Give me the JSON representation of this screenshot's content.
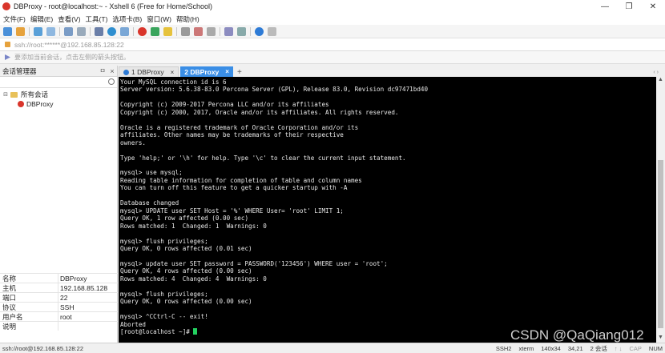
{
  "window": {
    "title": "DBProxy - root@localhost:~ - Xshell 6 (Free for Home/School)",
    "controls": [
      "—",
      "❐",
      "✕"
    ]
  },
  "menu": [
    "文件(F)",
    "编辑(E)",
    "查看(V)",
    "工具(T)",
    "选项卡(B)",
    "窗口(W)",
    "帮助(H)"
  ],
  "address": {
    "text": "ssh://root:******@192.168.85.128:22"
  },
  "hint": {
    "text": "要添加当前会话，点击左侧的箭头按钮。"
  },
  "sidebar": {
    "title": "会话管理器",
    "pin": "ㅁ",
    "close": "×",
    "tree": {
      "root_label": "所有会话",
      "session_label": "DBProxy"
    },
    "properties": [
      {
        "key": "名称",
        "value": "DBProxy"
      },
      {
        "key": "主机",
        "value": "192.168.85.128"
      },
      {
        "key": "端口",
        "value": "22"
      },
      {
        "key": "协议",
        "value": "SSH"
      },
      {
        "key": "用户名",
        "value": "root"
      },
      {
        "key": "说明",
        "value": ""
      }
    ]
  },
  "tabs": {
    "tab1": "1 DBProxy",
    "tab2": "2 DBProxy",
    "add": "+",
    "arrows": "‹ ›"
  },
  "terminal": {
    "text": "Your MySQL connection id is 6\nServer version: 5.6.38-83.0 Percona Server (GPL), Release 83.0, Revision dc97471bd40\n\nCopyright (c) 2009-2017 Percona LLC and/or its affiliates\nCopyright (c) 2000, 2017, Oracle and/or its affiliates. All rights reserved.\n\nOracle is a registered trademark of Oracle Corporation and/or its\naffiliates. Other names may be trademarks of their respective\nowners.\n\nType 'help;' or '\\h' for help. Type '\\c' to clear the current input statement.\n\nmysql> use mysql;\nReading table information for completion of table and column names\nYou can turn off this feature to get a quicker startup with -A\n\nDatabase changed\nmysql> UPDATE user SET Host = '%' WHERE User= 'root' LIMIT 1;\nQuery OK, 1 row affected (0.00 sec)\nRows matched: 1  Changed: 1  Warnings: 0\n\nmysql> flush privileges;\nQuery OK, 0 rows affected (0.01 sec)\n\nmysql> update user SET password = PASSWORD('123456') WHERE user = 'root';\nQuery OK, 4 rows affected (0.00 sec)\nRows matched: 4  Changed: 4  Warnings: 0\n\nmysql> flush privileges;\nQuery OK, 0 rows affected (0.00 sec)\n\nmysql> ^CCtrl-C -- exit!\nAborted\n",
    "prompt": "[root@localhost ~]# "
  },
  "watermark": "CSDN @QaQiang012",
  "status": {
    "left": "ssh://root@192.168.85.128:22",
    "protocol": "SSH2",
    "term": "xterm",
    "size": "140x34",
    "cursor_pos": "34,21",
    "sessions": "2 会话",
    "arrows": "↑ ↓",
    "caps": "CAP",
    "num": "NUM"
  },
  "colors": {
    "active_tab": "#3a8ee6",
    "terminal_bg": "#000000",
    "cursor": "#23d160",
    "session_icon": "#d9352b"
  }
}
